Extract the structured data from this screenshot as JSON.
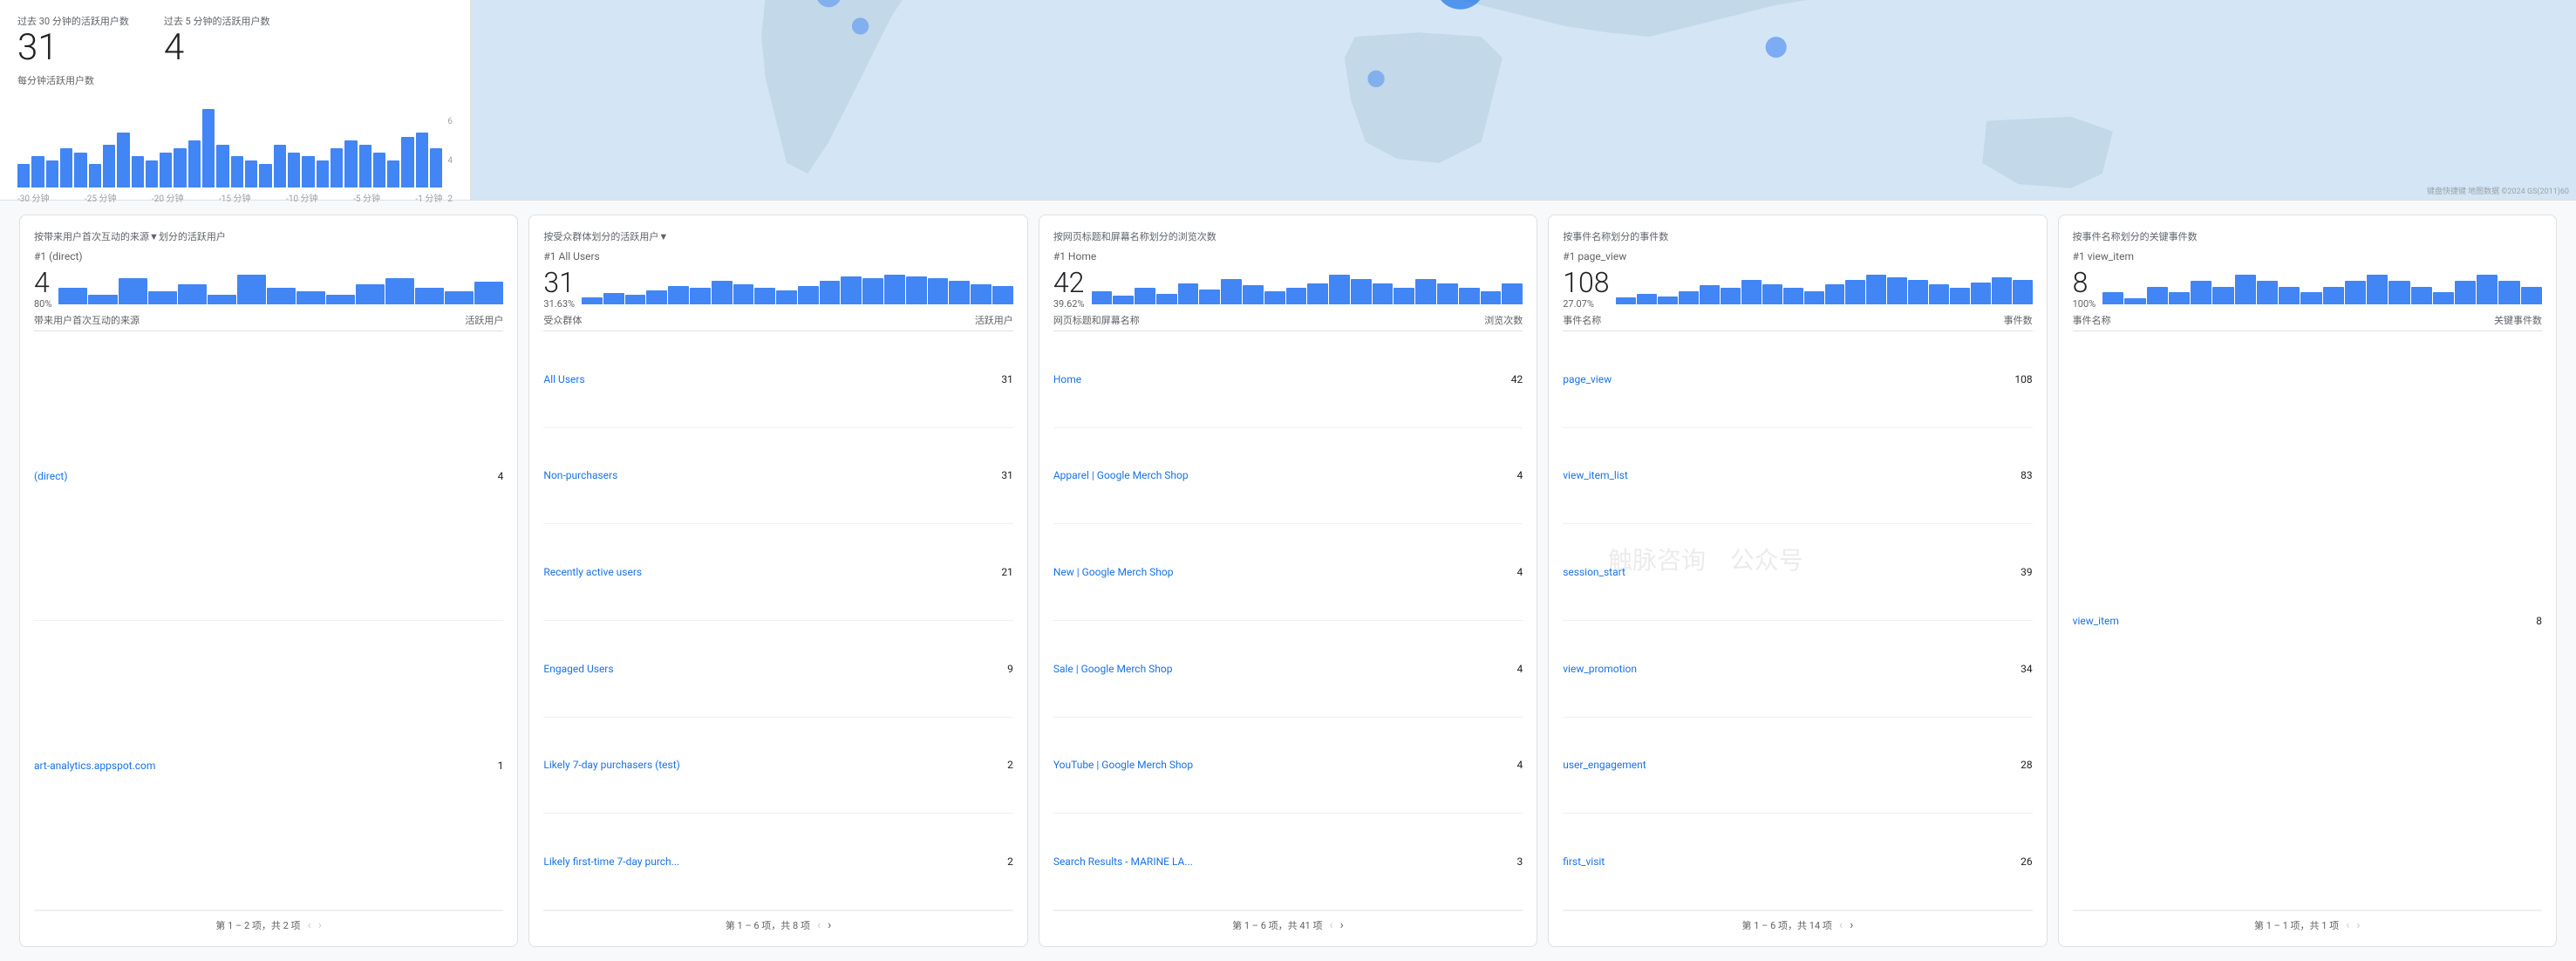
{
  "top": {
    "stat1_label": "过去 30 分钟的活跃用户数",
    "stat1_value": "31",
    "stat2_label": "过去 5 分钟的活跃用户数",
    "stat2_value": "4",
    "chart_label": "每分钟活跃用户数",
    "x_axis_labels": [
      "-30 分钟",
      "-25 分钟",
      "-20 分钟",
      "-15 分钟",
      "-10 分钟",
      "-5 分钟",
      "-1 分钟"
    ],
    "y_axis_labels": [
      "6",
      "4",
      "2"
    ],
    "bar_heights": [
      30,
      40,
      35,
      50,
      45,
      30,
      55,
      70,
      40,
      35,
      45,
      50,
      60,
      100,
      55,
      40,
      35,
      30,
      55,
      45,
      40,
      35,
      50,
      60,
      55,
      45,
      35,
      65,
      70,
      50
    ],
    "map_note": "键盘快捷键  地图数据 ©2024 GS(2011)60"
  },
  "cards": [
    {
      "id": "card1",
      "title": "按带来用户首次互动的来源▼划分的活跃用户",
      "rank": "#1 (direct)",
      "top_value": "4",
      "top_pct": "80%",
      "col1": "带来用户首次互动的来源",
      "col2": "活跃用户",
      "rows": [
        {
          "name": "(direct)",
          "value": "4"
        },
        {
          "name": "art-analytics.appspot.com",
          "value": "1"
        }
      ],
      "footer": "第 1 – 2 项，共 2 项",
      "prev_disabled": true,
      "next_disabled": true,
      "mini_bars": [
        5,
        3,
        8,
        4,
        6,
        3,
        9,
        5,
        4,
        3,
        6,
        8,
        5,
        4,
        7
      ],
      "show_mini": true
    },
    {
      "id": "card2",
      "title": "按受众群体划分的活跃用户▼",
      "rank": "#1 All Users",
      "top_value": "31",
      "top_pct": "31.63%",
      "col1": "受众群体",
      "col2": "活跃用户",
      "rows": [
        {
          "name": "All Users",
          "value": "31"
        },
        {
          "name": "Non-purchasers",
          "value": "31"
        },
        {
          "name": "Recently active users",
          "value": "21"
        },
        {
          "name": "Engaged Users",
          "value": "9"
        },
        {
          "name": "Likely 7-day purchasers (test)",
          "value": "2"
        },
        {
          "name": "Likely first-time 7-day purch...",
          "value": "2"
        }
      ],
      "footer": "第 1 – 6 项，共 8 项",
      "prev_disabled": true,
      "next_disabled": false,
      "mini_bars": [
        8,
        12,
        10,
        15,
        20,
        18,
        25,
        22,
        18,
        15,
        20,
        25,
        30,
        28,
        32,
        30,
        28,
        25,
        22,
        20
      ],
      "show_mini": true
    },
    {
      "id": "card3",
      "title": "按网页标题和屏幕名称划分的浏览次数",
      "rank": "#1 Home",
      "top_value": "42",
      "top_pct": "39.62%",
      "col1": "网页标题和屏幕名称",
      "col2": "浏览次数",
      "rows": [
        {
          "name": "Home",
          "value": "42"
        },
        {
          "name": "Apparel | Google Merch Shop",
          "value": "4"
        },
        {
          "name": "New | Google Merch Shop",
          "value": "4"
        },
        {
          "name": "Sale | Google Merch Shop",
          "value": "4"
        },
        {
          "name": "YouTube | Google Merch Shop",
          "value": "4"
        },
        {
          "name": "Search Results - MARINE LA...",
          "value": "3"
        }
      ],
      "footer": "第 1 – 6 项，共 41 项",
      "prev_disabled": true,
      "next_disabled": false,
      "mini_bars": [
        6,
        4,
        8,
        5,
        10,
        7,
        12,
        9,
        6,
        8,
        10,
        14,
        12,
        10,
        8,
        12,
        10,
        8,
        6,
        10
      ],
      "show_mini": true
    },
    {
      "id": "card4",
      "title": "按事件名称划分的事件数",
      "rank": "#1 page_view",
      "top_value": "108",
      "top_pct": "27.07%",
      "col1": "事件名称",
      "col2": "事件数",
      "rows": [
        {
          "name": "page_view",
          "value": "108"
        },
        {
          "name": "view_item_list",
          "value": "83"
        },
        {
          "name": "session_start",
          "value": "39"
        },
        {
          "name": "view_promotion",
          "value": "34"
        },
        {
          "name": "user_engagement",
          "value": "28"
        },
        {
          "name": "first_visit",
          "value": "26"
        }
      ],
      "footer": "第 1 – 6 项，共 14 项",
      "prev_disabled": true,
      "next_disabled": false,
      "mini_bars": [
        5,
        8,
        6,
        10,
        14,
        12,
        18,
        15,
        12,
        10,
        15,
        18,
        22,
        20,
        18,
        15,
        12,
        16,
        20,
        18
      ],
      "show_mini": true
    },
    {
      "id": "card5",
      "title": "按事件名称划分的关键事件数",
      "rank": "#1  view_item",
      "top_value": "8",
      "top_pct": "100%",
      "col1": "事件名称",
      "col2": "关键事件数",
      "rows": [
        {
          "name": "view_item",
          "value": "8"
        }
      ],
      "footer": "第 1 – 1 项，共 1 项",
      "prev_disabled": true,
      "next_disabled": true,
      "mini_bars": [
        2,
        1,
        3,
        2,
        4,
        3,
        5,
        4,
        3,
        2,
        3,
        4,
        5,
        4,
        3,
        2,
        4,
        5,
        4,
        3
      ],
      "show_mini": true
    }
  ]
}
